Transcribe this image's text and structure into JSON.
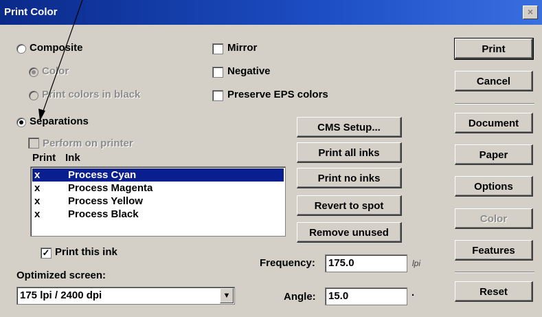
{
  "window": {
    "title": "Print Color",
    "close_glyph": "×"
  },
  "options": {
    "composite": "Composite",
    "color": "Color",
    "print_colors_in_black": "Print colors in black",
    "separations": "Separations",
    "perform_on_printer": "Perform on printer",
    "mirror": "Mirror",
    "negative": "Negative",
    "preserve_eps": "Preserve EPS colors"
  },
  "ink_list": {
    "header_print": "Print",
    "header_ink": "Ink",
    "rows": [
      {
        "mark": "x",
        "name": "Process Cyan",
        "selected": true
      },
      {
        "mark": "x",
        "name": "Process Magenta"
      },
      {
        "mark": "x",
        "name": "Process Yellow"
      },
      {
        "mark": "x",
        "name": "Process Black"
      }
    ]
  },
  "print_this_ink": "Print this ink",
  "print_this_ink_check": "✓",
  "optimized_screen": {
    "label": "Optimized screen:",
    "value": "175 lpi / 2400 dpi"
  },
  "frequency": {
    "label": "Frequency:",
    "value": "175.0",
    "unit": "lpi"
  },
  "angle": {
    "label": "Angle:",
    "value": "15.0",
    "unit": "·"
  },
  "middle_buttons": {
    "cms_setup": "CMS Setup...",
    "print_all_inks": "Print all inks",
    "print_no_inks": "Print no inks",
    "revert_to_spot": "Revert to spot",
    "remove_unused": "Remove unused"
  },
  "right_buttons": {
    "print": "Print",
    "cancel": "Cancel",
    "document": "Document",
    "paper": "Paper",
    "options": "Options",
    "color": "Color",
    "features": "Features",
    "reset": "Reset"
  }
}
